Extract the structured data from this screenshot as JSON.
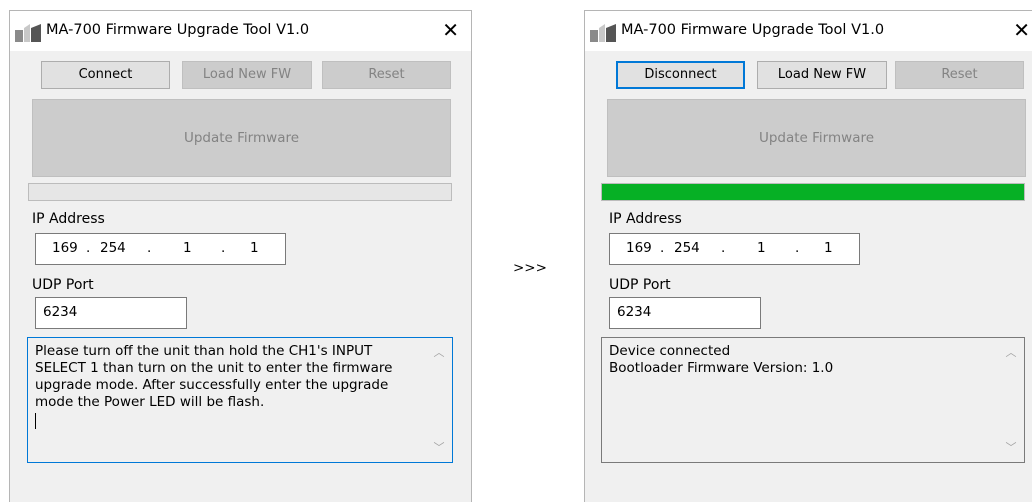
{
  "transition_label": ">>>",
  "colors": {
    "progress_fill": "#06b025",
    "focus_border": "#0078d7"
  },
  "icons": {
    "app": "app-logo-icon",
    "close": "close-icon",
    "scroll_up": "chevron-up-icon",
    "scroll_down": "chevron-down-icon"
  },
  "before": {
    "title": "MA-700 Firmware Upgrade Tool V1.0",
    "close_glyph": "✕",
    "buttons": {
      "connect": "Connect",
      "load": "Load New FW",
      "reset": "Reset",
      "update": "Update Firmware"
    },
    "progress": 0,
    "ip_label": "IP Address",
    "ip": {
      "o1": "169",
      "o2": "254",
      "o3": "1",
      "o4": "1",
      "dot": "."
    },
    "port_label": "UDP Port",
    "port": "6234",
    "message": [
      "Please turn off the unit than hold the CH1's INPUT",
      "SELECT 1 than turn on the unit to enter the firmware",
      "upgrade mode. After successfully enter the upgrade",
      "mode the Power LED will be flash."
    ]
  },
  "after": {
    "title": "MA-700 Firmware Upgrade Tool V1.0",
    "close_glyph": "✕",
    "buttons": {
      "connect": "Disconnect",
      "load": "Load New FW",
      "reset": "Reset",
      "update": "Update Firmware"
    },
    "progress": 100,
    "ip_label": "IP Address",
    "ip": {
      "o1": "169",
      "o2": "254",
      "o3": "1",
      "o4": "1",
      "dot": "."
    },
    "port_label": "UDP Port",
    "port": "6234",
    "message": [
      "Device connected",
      "Bootloader Firmware Version: 1.0"
    ]
  }
}
